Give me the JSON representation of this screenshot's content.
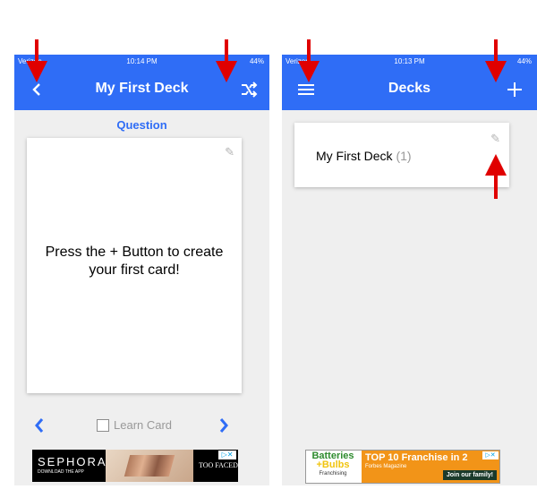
{
  "colors": {
    "accent": "#2f6df6",
    "arrow": "#e00000",
    "background": "#efefef"
  },
  "left_screen": {
    "status": {
      "carrier": "Verizon",
      "time": "10:14 PM",
      "battery": "44%"
    },
    "header": {
      "title": "My First Deck",
      "back_icon": "chevron-left-icon",
      "shuffle_icon": "shuffle-icon"
    },
    "question_label": "Question",
    "card": {
      "prompt": "Press the + Button to create your first card!",
      "edit_icon": "pencil-icon"
    },
    "bottom": {
      "prev_icon": "chevron-left-icon",
      "learn_label": "Learn Card",
      "next_icon": "chevron-right-icon"
    },
    "ad": {
      "brand": "SEPHORA",
      "tagline": "DOWNLOAD THE APP",
      "partner": "TOO FACED"
    }
  },
  "right_screen": {
    "status": {
      "carrier": "Verizon",
      "time": "10:13 PM",
      "battery": "44%"
    },
    "header": {
      "title": "Decks",
      "menu_icon": "hamburger-menu-icon",
      "add_icon": "plus-icon"
    },
    "decks": [
      {
        "name": "My First Deck",
        "count": "(1)"
      }
    ],
    "ad": {
      "brand_line1": "Batteries",
      "brand_line2": "+Bulbs",
      "brand_line3": "Franchising",
      "headline": "TOP 10 Franchise in 2",
      "source": "Forbes Magazine",
      "cta": "Join our family!"
    }
  }
}
